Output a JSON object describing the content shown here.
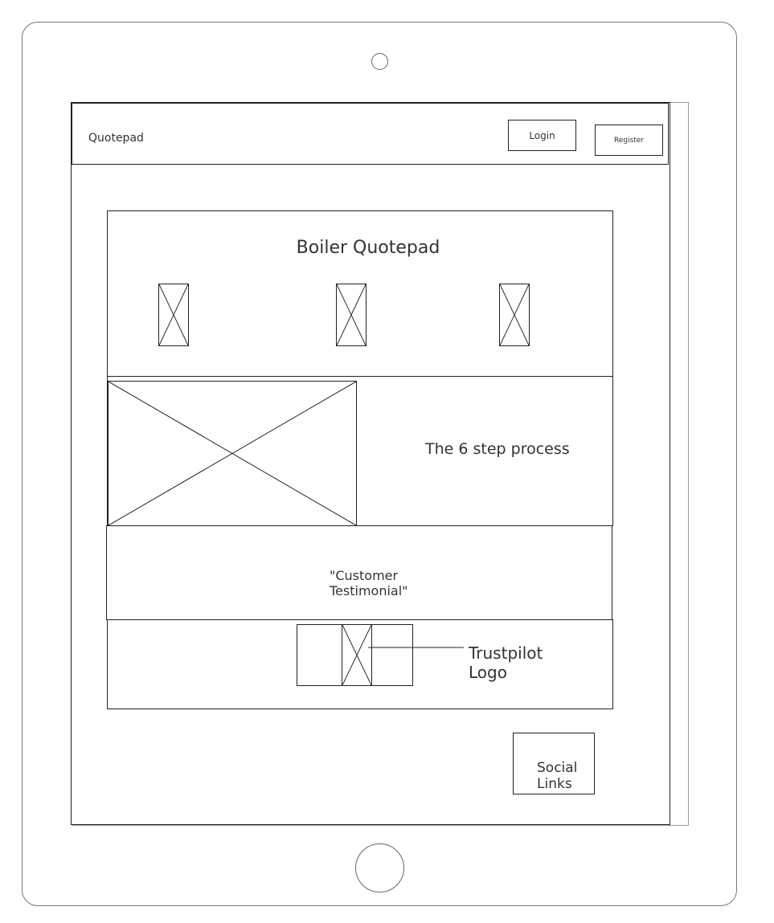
{
  "header": {
    "brand": "Quotepad",
    "login_label": "Login",
    "register_label": "Register"
  },
  "hero": {
    "title": "Boiler Quotepad"
  },
  "process": {
    "text": "The 6 step process"
  },
  "testimonial": {
    "line1": "\"Customer",
    "line2": "Testimonial\""
  },
  "trustpilot": {
    "line1": "Trustpilot",
    "line2": "Logo"
  },
  "social": {
    "line1": "Social",
    "line2": "Links"
  }
}
